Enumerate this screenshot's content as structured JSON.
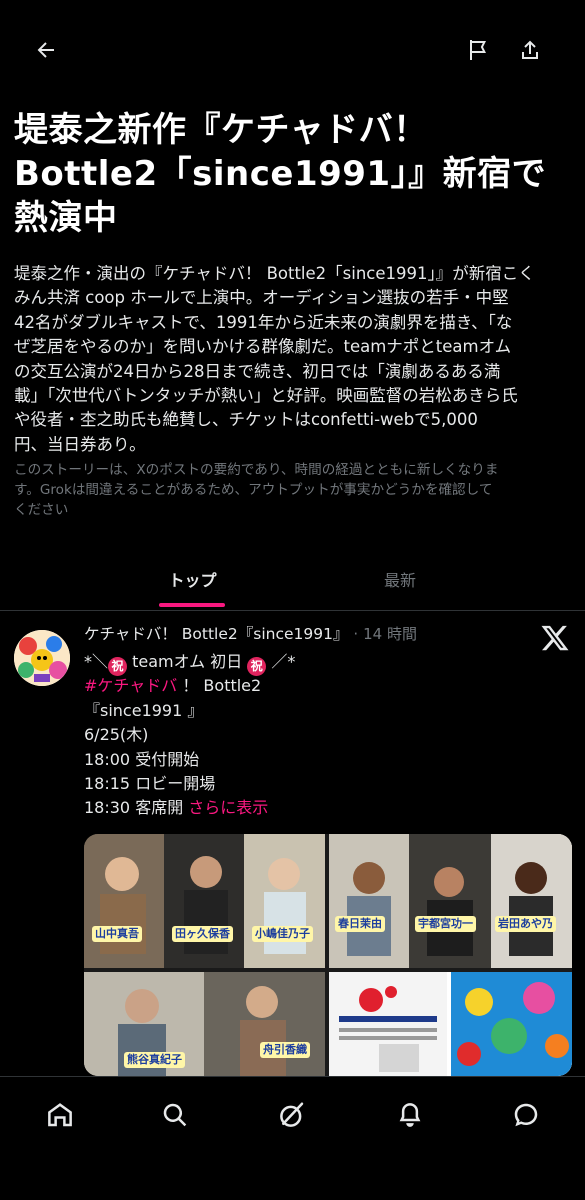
{
  "header": {
    "back_icon": "arrow-left-icon",
    "flag_icon": "flag-icon",
    "share_icon": "share-icon"
  },
  "story": {
    "headline_lines": [
      "堤泰之新作『ケチャドバ！",
      "Bottle2「since1991」』新宿で",
      "熱演中"
    ],
    "summary_lines": [
      "堤泰之作・演出の『ケチャドバ！ Bottle2「since1991」』が新宿こく",
      "みん共済 coop ホールで上演中。オーディション選抜の若手・中堅",
      "42名がダブルキャストで、1991年から近未来の演劇界を描き、「な",
      "ぜ芝居をやるのか」を問いかける群像劇だ。teamナポとteamオム",
      "の交互公演が24日から28日まで続き、初日では「演劇あるある満",
      "載」「次世代バトンタッチが熱い」と好評。映画監督の岩松あきら氏",
      "や役者・杢之助氏も絶賛し、チケットはconfetti-webで5,000",
      "円、当日券あり。"
    ],
    "disclaimer_lines": [
      "このストーリーは、Xのポストの要約であり、時間の経過とともに新しくなりま",
      "す。Grokは間違えることがあるため、アウトプットが事実かどうかを確認して",
      "ください"
    ]
  },
  "tabs": {
    "top": "トップ",
    "latest": "最新",
    "active": "top",
    "accent_color": "#f91880"
  },
  "post": {
    "author": "ケチャドバ！ Bottle2『since1991』",
    "separator": "·",
    "time": "14 時間",
    "platform_icon": "x-logo-icon",
    "line1_pre": "*＼",
    "line1_badge": "祝",
    "line1_mid": " teamオム 初日 ",
    "line1_badge2": "祝",
    "line1_post": " ／*",
    "hashtag": "#ケチャドバ",
    "line2_rest": " ！ Bottle2",
    "line3": "『since1991 』",
    "line4": "6/25(木)",
    "line5": "18:00 受付開始",
    "line6": "18:15 ロビー開場",
    "line7": "18:30 客席開",
    "more_label": "さらに表示",
    "media_captions": [
      "山中真吾",
      "田ヶ久保香",
      "小嶋佳乃子",
      "春日茉由",
      "宇都宮功一",
      "岩田あや乃",
      "熊谷真紀子",
      "舟引香織"
    ]
  },
  "nav": {
    "items": [
      "home-icon",
      "search-icon",
      "grok-icon",
      "bell-icon",
      "messages-icon"
    ]
  }
}
